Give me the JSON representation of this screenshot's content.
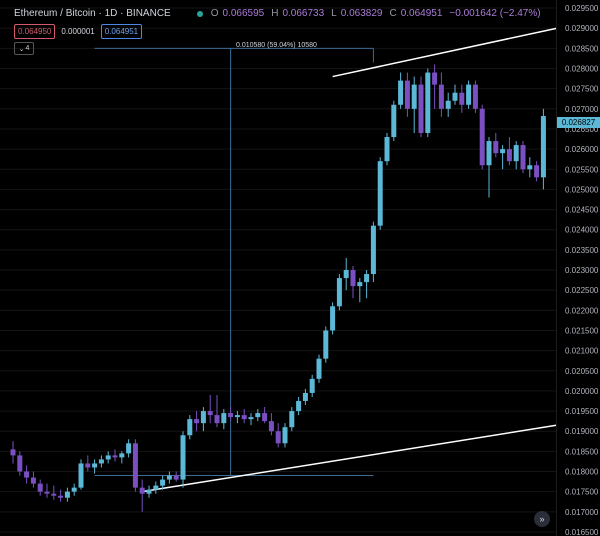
{
  "header": {
    "symbol": "Ethereum / Bitcoin · 1D · BINANCE",
    "ohlc": [
      {
        "key": "O",
        "value": "0.066595"
      },
      {
        "key": "H",
        "value": "0.066733"
      },
      {
        "key": "L",
        "value": "0.063829"
      },
      {
        "key": "C",
        "value": "0.064951"
      },
      {
        "key": "",
        "value": "−0.001642 (−2.47%)"
      }
    ]
  },
  "trade": {
    "sell": "0.064950",
    "spread": "0.000001",
    "buy": "0.064951"
  },
  "collapse_label": "4",
  "measure_label": "0.010580 (59.04%) 10580",
  "last_price": "0.026827",
  "scroll_glyph": "»",
  "colors": {
    "up": "#5bb8d6",
    "down": "#7a4fc2",
    "grid": "#141414",
    "trend": "#ffffff",
    "measure": "#3d6c95"
  },
  "chart_data": {
    "type": "candlestick",
    "title": "Ethereum / Bitcoin · 1D · BINANCE",
    "ylim": [
      0.0164,
      0.0297
    ],
    "y_ticks": [
      0.0295,
      0.029,
      0.0285,
      0.028,
      0.0275,
      0.027,
      0.0265,
      0.026,
      0.0255,
      0.025,
      0.0245,
      0.024,
      0.0235,
      0.023,
      0.0225,
      0.022,
      0.0215,
      0.021,
      0.0205,
      0.02,
      0.0195,
      0.019,
      0.0185,
      0.018,
      0.0175,
      0.017,
      0.0165
    ],
    "y_tick_labels": [
      "0.029500",
      "0.029000",
      "0.028500",
      "0.028000",
      "0.027500",
      "0.027000",
      "0.026500",
      "0.026000",
      "0.025500",
      "0.025000",
      "0.024500",
      "0.024000",
      "0.023500",
      "0.023000",
      "0.022500",
      "0.022000",
      "0.021500",
      "0.021000",
      "0.020500",
      "0.020000",
      "0.019500",
      "0.019000",
      "0.018500",
      "0.018000",
      "0.017500",
      "0.017000",
      "0.016500"
    ],
    "candles": [
      [
        0.01855,
        0.01875,
        0.0182,
        0.0184
      ],
      [
        0.0184,
        0.0185,
        0.0179,
        0.018
      ],
      [
        0.018,
        0.01815,
        0.0177,
        0.01785
      ],
      [
        0.01785,
        0.018,
        0.0176,
        0.0177
      ],
      [
        0.0177,
        0.0178,
        0.0174,
        0.0175
      ],
      [
        0.0175,
        0.0177,
        0.01735,
        0.01745
      ],
      [
        0.01745,
        0.01765,
        0.0173,
        0.0174
      ],
      [
        0.0174,
        0.01755,
        0.01725,
        0.01735
      ],
      [
        0.01735,
        0.0176,
        0.01725,
        0.0175
      ],
      [
        0.0175,
        0.0177,
        0.0174,
        0.0176
      ],
      [
        0.0176,
        0.0183,
        0.01755,
        0.0182
      ],
      [
        0.0182,
        0.0184,
        0.018,
        0.0181
      ],
      [
        0.0181,
        0.0183,
        0.01795,
        0.0182
      ],
      [
        0.0182,
        0.0184,
        0.0181,
        0.0183
      ],
      [
        0.0183,
        0.0185,
        0.0182,
        0.0184
      ],
      [
        0.0184,
        0.01855,
        0.01825,
        0.01835
      ],
      [
        0.01835,
        0.0185,
        0.0182,
        0.01845
      ],
      [
        0.01845,
        0.0188,
        0.01835,
        0.0187
      ],
      [
        0.0187,
        0.0188,
        0.0175,
        0.0176
      ],
      [
        0.0176,
        0.0178,
        0.017,
        0.01745
      ],
      [
        0.01745,
        0.01765,
        0.01735,
        0.01755
      ],
      [
        0.01755,
        0.01775,
        0.01745,
        0.01765
      ],
      [
        0.01765,
        0.0179,
        0.01755,
        0.0178
      ],
      [
        0.0178,
        0.018,
        0.0177,
        0.0179
      ],
      [
        0.0179,
        0.018,
        0.01775,
        0.0178
      ],
      [
        0.0178,
        0.019,
        0.0176,
        0.0189
      ],
      [
        0.0189,
        0.0194,
        0.0188,
        0.0193
      ],
      [
        0.0193,
        0.0195,
        0.019,
        0.0192
      ],
      [
        0.0192,
        0.0196,
        0.019,
        0.0195
      ],
      [
        0.0195,
        0.0199,
        0.0192,
        0.0194
      ],
      [
        0.0194,
        0.0199,
        0.0191,
        0.0192
      ],
      [
        0.0192,
        0.01955,
        0.01905,
        0.01945
      ],
      [
        0.01945,
        0.0196,
        0.01925,
        0.01935
      ],
      [
        0.01935,
        0.0195,
        0.0192,
        0.0194
      ],
      [
        0.0194,
        0.01955,
        0.0192,
        0.0193
      ],
      [
        0.0193,
        0.01945,
        0.01915,
        0.01935
      ],
      [
        0.01935,
        0.01955,
        0.01925,
        0.01945
      ],
      [
        0.01945,
        0.0196,
        0.0192,
        0.01925
      ],
      [
        0.01925,
        0.01945,
        0.0189,
        0.019
      ],
      [
        0.019,
        0.0192,
        0.0186,
        0.0187
      ],
      [
        0.0187,
        0.0192,
        0.0186,
        0.0191
      ],
      [
        0.0191,
        0.0196,
        0.019,
        0.0195
      ],
      [
        0.0195,
        0.01985,
        0.0194,
        0.01975
      ],
      [
        0.01975,
        0.02005,
        0.01965,
        0.01995
      ],
      [
        0.01995,
        0.0204,
        0.01985,
        0.0203
      ],
      [
        0.0203,
        0.0209,
        0.0202,
        0.0208
      ],
      [
        0.0208,
        0.0216,
        0.0207,
        0.0215
      ],
      [
        0.0215,
        0.0222,
        0.0214,
        0.0221
      ],
      [
        0.0221,
        0.0229,
        0.022,
        0.0228
      ],
      [
        0.0228,
        0.0233,
        0.0225,
        0.023
      ],
      [
        0.023,
        0.0231,
        0.0223,
        0.0226
      ],
      [
        0.0226,
        0.0228,
        0.0222,
        0.0227
      ],
      [
        0.0227,
        0.023,
        0.0223,
        0.0229
      ],
      [
        0.0229,
        0.0242,
        0.0227,
        0.0241
      ],
      [
        0.0241,
        0.0258,
        0.024,
        0.0257
      ],
      [
        0.0257,
        0.0264,
        0.0256,
        0.0263
      ],
      [
        0.0263,
        0.0272,
        0.0262,
        0.0271
      ],
      [
        0.0271,
        0.0279,
        0.027,
        0.0277
      ],
      [
        0.0277,
        0.0279,
        0.0268,
        0.027
      ],
      [
        0.027,
        0.0278,
        0.0264,
        0.0276
      ],
      [
        0.0276,
        0.0278,
        0.0263,
        0.0264
      ],
      [
        0.0264,
        0.028,
        0.0263,
        0.0279
      ],
      [
        0.0279,
        0.0281,
        0.027,
        0.0276
      ],
      [
        0.0276,
        0.0279,
        0.0268,
        0.027
      ],
      [
        0.027,
        0.0274,
        0.0268,
        0.0272
      ],
      [
        0.0272,
        0.0276,
        0.0271,
        0.0274
      ],
      [
        0.0274,
        0.0276,
        0.0269,
        0.0271
      ],
      [
        0.0271,
        0.0277,
        0.027,
        0.0276
      ],
      [
        0.0276,
        0.0277,
        0.0269,
        0.027
      ],
      [
        0.027,
        0.0271,
        0.0255,
        0.0256
      ],
      [
        0.0256,
        0.0263,
        0.0248,
        0.0262
      ],
      [
        0.0262,
        0.0264,
        0.0258,
        0.0259
      ],
      [
        0.0259,
        0.0261,
        0.0255,
        0.026
      ],
      [
        0.026,
        0.0263,
        0.0256,
        0.0257
      ],
      [
        0.0257,
        0.0262,
        0.0255,
        0.0261
      ],
      [
        0.0261,
        0.0262,
        0.0254,
        0.0255
      ],
      [
        0.0255,
        0.0258,
        0.0253,
        0.0256
      ],
      [
        0.0256,
        0.0257,
        0.0252,
        0.0253
      ],
      [
        0.0253,
        0.027,
        0.025,
        0.02682
      ]
    ],
    "annotations": {
      "trend_lower": [
        [
          19,
          0.0175
        ],
        [
          80,
          0.01915
        ]
      ],
      "trend_upper": [
        [
          47,
          0.0278
        ],
        [
          80,
          0.029
        ]
      ],
      "measure": {
        "x_start": 12,
        "x_end": 53,
        "x_mid": 32,
        "y_low": 0.0179,
        "y_high": 0.0285
      }
    }
  }
}
